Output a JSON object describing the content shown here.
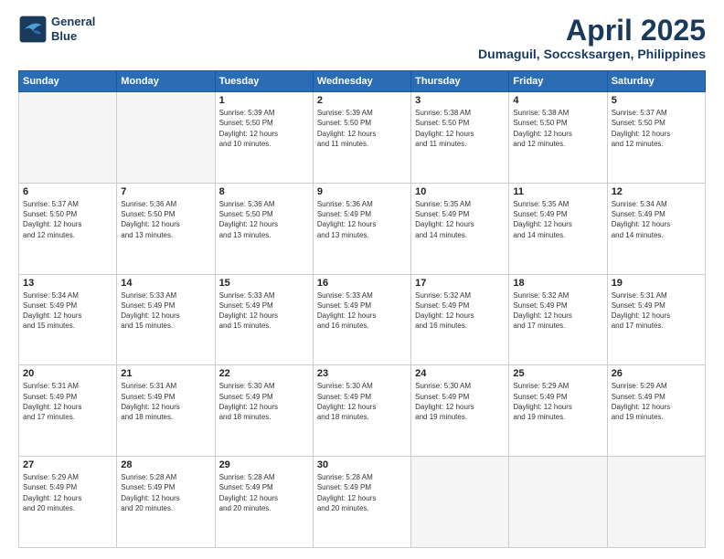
{
  "header": {
    "logo_line1": "General",
    "logo_line2": "Blue",
    "title": "April 2025",
    "subtitle": "Dumaguil, Soccsksargen, Philippines"
  },
  "weekdays": [
    "Sunday",
    "Monday",
    "Tuesday",
    "Wednesday",
    "Thursday",
    "Friday",
    "Saturday"
  ],
  "weeks": [
    [
      {
        "day": "",
        "info": ""
      },
      {
        "day": "",
        "info": ""
      },
      {
        "day": "1",
        "info": "Sunrise: 5:39 AM\nSunset: 5:50 PM\nDaylight: 12 hours\nand 10 minutes."
      },
      {
        "day": "2",
        "info": "Sunrise: 5:39 AM\nSunset: 5:50 PM\nDaylight: 12 hours\nand 11 minutes."
      },
      {
        "day": "3",
        "info": "Sunrise: 5:38 AM\nSunset: 5:50 PM\nDaylight: 12 hours\nand 11 minutes."
      },
      {
        "day": "4",
        "info": "Sunrise: 5:38 AM\nSunset: 5:50 PM\nDaylight: 12 hours\nand 12 minutes."
      },
      {
        "day": "5",
        "info": "Sunrise: 5:37 AM\nSunset: 5:50 PM\nDaylight: 12 hours\nand 12 minutes."
      }
    ],
    [
      {
        "day": "6",
        "info": "Sunrise: 5:37 AM\nSunset: 5:50 PM\nDaylight: 12 hours\nand 12 minutes."
      },
      {
        "day": "7",
        "info": "Sunrise: 5:36 AM\nSunset: 5:50 PM\nDaylight: 12 hours\nand 13 minutes."
      },
      {
        "day": "8",
        "info": "Sunrise: 5:36 AM\nSunset: 5:50 PM\nDaylight: 12 hours\nand 13 minutes."
      },
      {
        "day": "9",
        "info": "Sunrise: 5:36 AM\nSunset: 5:49 PM\nDaylight: 12 hours\nand 13 minutes."
      },
      {
        "day": "10",
        "info": "Sunrise: 5:35 AM\nSunset: 5:49 PM\nDaylight: 12 hours\nand 14 minutes."
      },
      {
        "day": "11",
        "info": "Sunrise: 5:35 AM\nSunset: 5:49 PM\nDaylight: 12 hours\nand 14 minutes."
      },
      {
        "day": "12",
        "info": "Sunrise: 5:34 AM\nSunset: 5:49 PM\nDaylight: 12 hours\nand 14 minutes."
      }
    ],
    [
      {
        "day": "13",
        "info": "Sunrise: 5:34 AM\nSunset: 5:49 PM\nDaylight: 12 hours\nand 15 minutes."
      },
      {
        "day": "14",
        "info": "Sunrise: 5:33 AM\nSunset: 5:49 PM\nDaylight: 12 hours\nand 15 minutes."
      },
      {
        "day": "15",
        "info": "Sunrise: 5:33 AM\nSunset: 5:49 PM\nDaylight: 12 hours\nand 15 minutes."
      },
      {
        "day": "16",
        "info": "Sunrise: 5:33 AM\nSunset: 5:49 PM\nDaylight: 12 hours\nand 16 minutes."
      },
      {
        "day": "17",
        "info": "Sunrise: 5:32 AM\nSunset: 5:49 PM\nDaylight: 12 hours\nand 16 minutes."
      },
      {
        "day": "18",
        "info": "Sunrise: 5:32 AM\nSunset: 5:49 PM\nDaylight: 12 hours\nand 17 minutes."
      },
      {
        "day": "19",
        "info": "Sunrise: 5:31 AM\nSunset: 5:49 PM\nDaylight: 12 hours\nand 17 minutes."
      }
    ],
    [
      {
        "day": "20",
        "info": "Sunrise: 5:31 AM\nSunset: 5:49 PM\nDaylight: 12 hours\nand 17 minutes."
      },
      {
        "day": "21",
        "info": "Sunrise: 5:31 AM\nSunset: 5:49 PM\nDaylight: 12 hours\nand 18 minutes."
      },
      {
        "day": "22",
        "info": "Sunrise: 5:30 AM\nSunset: 5:49 PM\nDaylight: 12 hours\nand 18 minutes."
      },
      {
        "day": "23",
        "info": "Sunrise: 5:30 AM\nSunset: 5:49 PM\nDaylight: 12 hours\nand 18 minutes."
      },
      {
        "day": "24",
        "info": "Sunrise: 5:30 AM\nSunset: 5:49 PM\nDaylight: 12 hours\nand 19 minutes."
      },
      {
        "day": "25",
        "info": "Sunrise: 5:29 AM\nSunset: 5:49 PM\nDaylight: 12 hours\nand 19 minutes."
      },
      {
        "day": "26",
        "info": "Sunrise: 5:29 AM\nSunset: 5:49 PM\nDaylight: 12 hours\nand 19 minutes."
      }
    ],
    [
      {
        "day": "27",
        "info": "Sunrise: 5:29 AM\nSunset: 5:49 PM\nDaylight: 12 hours\nand 20 minutes."
      },
      {
        "day": "28",
        "info": "Sunrise: 5:28 AM\nSunset: 5:49 PM\nDaylight: 12 hours\nand 20 minutes."
      },
      {
        "day": "29",
        "info": "Sunrise: 5:28 AM\nSunset: 5:49 PM\nDaylight: 12 hours\nand 20 minutes."
      },
      {
        "day": "30",
        "info": "Sunrise: 5:28 AM\nSunset: 5:49 PM\nDaylight: 12 hours\nand 20 minutes."
      },
      {
        "day": "",
        "info": ""
      },
      {
        "day": "",
        "info": ""
      },
      {
        "day": "",
        "info": ""
      }
    ]
  ]
}
